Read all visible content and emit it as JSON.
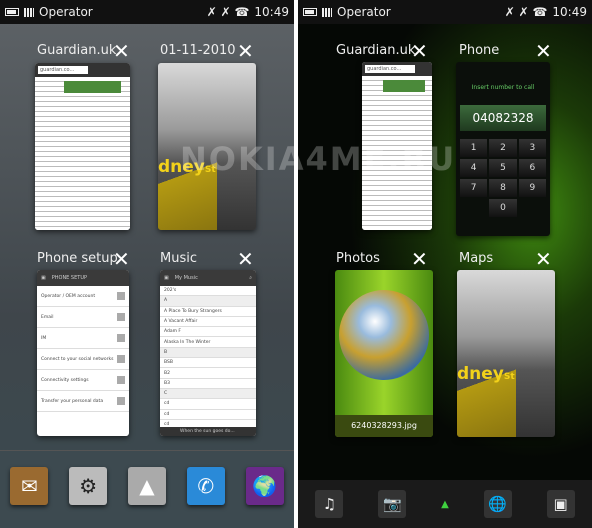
{
  "left": {
    "status": {
      "operator": "Operator",
      "time": "10:49"
    },
    "tasks": [
      {
        "title": "Guardian.uk",
        "url": "guardian.co..."
      },
      {
        "title": "01-11-2010",
        "sign": "dney",
        "sign_suffix": "St"
      },
      {
        "title": "Phone setup",
        "header": "PHONE SETUP",
        "rows": [
          "Operator / OEM account",
          "Email",
          "IM",
          "Connect to your social networks",
          "Connectivity settings",
          "Transfer your personal data"
        ]
      },
      {
        "title": "Music",
        "header": "My Music",
        "rows": [
          "202's",
          "A",
          "A Place To Bury Strangers",
          "A Vacant Affair",
          "Adam F",
          "Alaska In The Winter",
          "B",
          "BSB",
          "B2",
          "B3",
          "C",
          "cd",
          "cd",
          "cd"
        ],
        "now_playing": "When the sun goes do..."
      }
    ],
    "dock": [
      {
        "name": "mail",
        "glyph": "✉"
      },
      {
        "name": "settings",
        "glyph": "⚙"
      },
      {
        "name": "task-switcher",
        "glyph": "▲"
      },
      {
        "name": "phone",
        "glyph": "✆"
      },
      {
        "name": "maps",
        "glyph": "🌍"
      }
    ]
  },
  "right": {
    "status": {
      "operator": "Operator",
      "time": "10:49"
    },
    "tasks": [
      {
        "title": "Guardian.uk",
        "url": "guardian.co..."
      },
      {
        "title": "Phone",
        "prompt": "Insert number to call",
        "number": "04082328",
        "keys": [
          "1",
          "2",
          "3",
          "4",
          "5",
          "6",
          "7",
          "8",
          "9",
          "0"
        ]
      },
      {
        "title": "Photos",
        "caption": "6240328293.jpg"
      },
      {
        "title": "Maps",
        "sign": "dney",
        "sign_suffix": "St"
      }
    ],
    "dock": [
      {
        "name": "music",
        "glyph": "♫"
      },
      {
        "name": "camera",
        "glyph": "📷"
      },
      {
        "name": "task-switcher",
        "glyph": "▲"
      },
      {
        "name": "browser",
        "glyph": "🌐"
      },
      {
        "name": "contacts",
        "glyph": "▣"
      }
    ]
  },
  "watermark": "NOKIA4ME.RU",
  "close_glyph": "✕",
  "colors": {
    "accent_green": "#3fd13f",
    "sign_yellow": "#f3d21a"
  }
}
